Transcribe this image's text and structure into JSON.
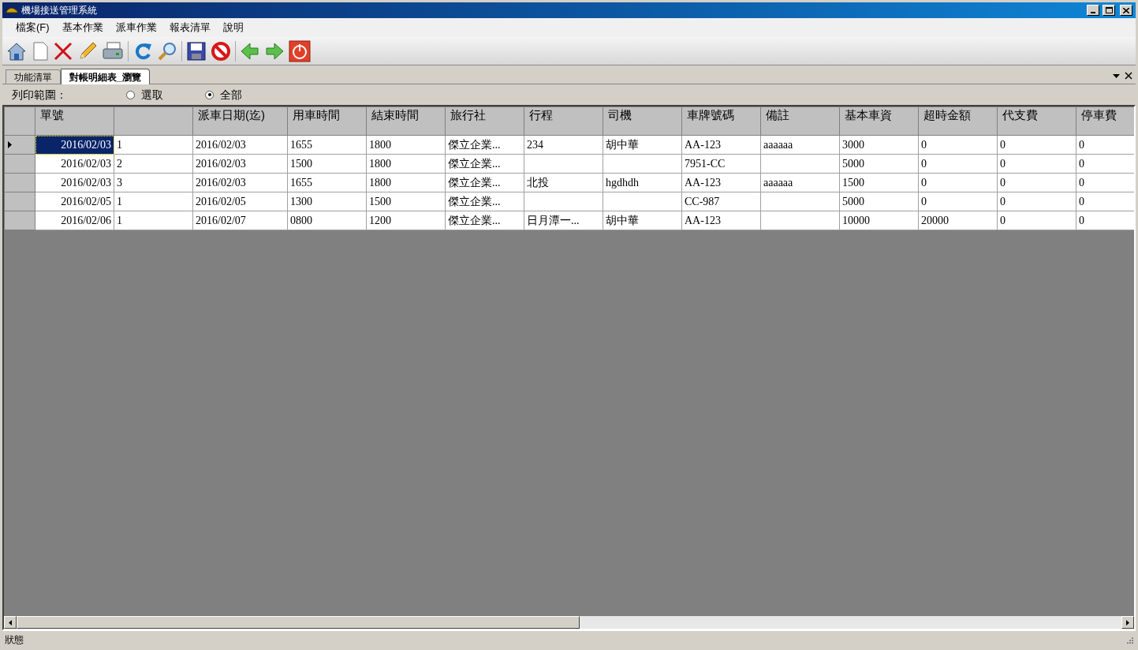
{
  "window": {
    "title": "機場接送管理系統"
  },
  "menu": [
    "檔案(F)",
    "基本作業",
    "派車作業",
    "報表清單",
    "說明"
  ],
  "tabs": [
    {
      "label": "功能清單",
      "selected": false
    },
    {
      "label": "對帳明細表_瀏覽",
      "selected": true
    }
  ],
  "print_range": {
    "label": "列印範圍：",
    "options": [
      {
        "label": "選取",
        "selected": false
      },
      {
        "label": "全部",
        "selected": true
      }
    ]
  },
  "table": {
    "columns": [
      "單號",
      "",
      "派車日期(迄)",
      "用車時間",
      "結束時間",
      "旅行社",
      "行程",
      "司機",
      "車牌號碼",
      "備註",
      "基本車資",
      "超時金額",
      "代支費",
      "停車費"
    ],
    "rows": [
      {
        "selected": true,
        "cells": [
          "2016/02/03",
          "1",
          "2016/02/03",
          "1655",
          "1800",
          "傑立企業...",
          "234",
          "胡中華",
          "AA-123",
          "aaaaaa",
          "3000",
          "0",
          "0",
          "0"
        ]
      },
      {
        "selected": false,
        "cells": [
          "2016/02/03",
          "2",
          "2016/02/03",
          "1500",
          "1800",
          "傑立企業...",
          "",
          "",
          "7951-CC",
          "",
          "5000",
          "0",
          "0",
          "0"
        ]
      },
      {
        "selected": false,
        "cells": [
          "2016/02/03",
          "3",
          "2016/02/03",
          "1655",
          "1800",
          "傑立企業...",
          "北投",
          "hgdhdh",
          "AA-123",
          "aaaaaa",
          "1500",
          "0",
          "0",
          "0"
        ]
      },
      {
        "selected": false,
        "cells": [
          "2016/02/05",
          "1",
          "2016/02/05",
          "1300",
          "1500",
          "傑立企業...",
          "",
          "",
          "CC-987",
          "",
          "5000",
          "0",
          "0",
          "0"
        ]
      },
      {
        "selected": false,
        "cells": [
          "2016/02/06",
          "1",
          "2016/02/07",
          "0800",
          "1200",
          "傑立企業...",
          "日月潭一...",
          "胡中華",
          "AA-123",
          "",
          "10000",
          "20000",
          "0",
          "0"
        ]
      }
    ]
  },
  "status_bar": "狀態"
}
